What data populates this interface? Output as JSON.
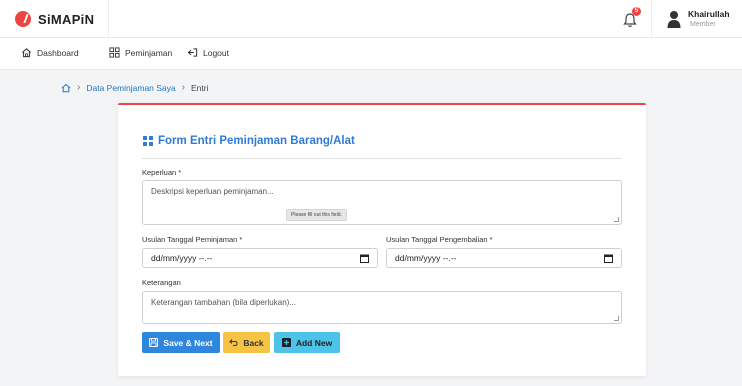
{
  "app": {
    "name": "SiMAPiN",
    "notification_count": "5"
  },
  "user": {
    "name": "Khairullah",
    "role": "Member"
  },
  "nav": {
    "dashboard": "Dashboard",
    "peminjaman": "Peminjaman",
    "logout": "Logout"
  },
  "breadcrumb": {
    "section": "Data Peminjaman Saya",
    "current": "Entri"
  },
  "form": {
    "title": "Form Entri Peminjaman Barang/Alat",
    "keperluan_label": "Keperluan *",
    "keperluan_placeholder": "Deskripsi keperluan peminjaman...",
    "validation_tooltip": "Please fill out this field.",
    "tanggal_pinjam_label": "Usulan Tanggal Peminjaman *",
    "tanggal_pinjam_value": "dd/mm/yyyy --.--",
    "tanggal_kembali_label": "Usulan Tanggal Pengembalian *",
    "tanggal_kembali_value": "dd/mm/yyyy --.--",
    "keterangan_label": "Keterangan",
    "keterangan_placeholder": "Keterangan tambahan (bila diperlukan)..."
  },
  "buttons": {
    "save_next": "Save & Next",
    "back": "Back",
    "add_new": "Add New"
  },
  "colors": {
    "brand": "#ef4444",
    "primary": "#2f86dd",
    "warning": "#f7c345",
    "info": "#4dc3ea",
    "title": "#2f7bd3"
  }
}
